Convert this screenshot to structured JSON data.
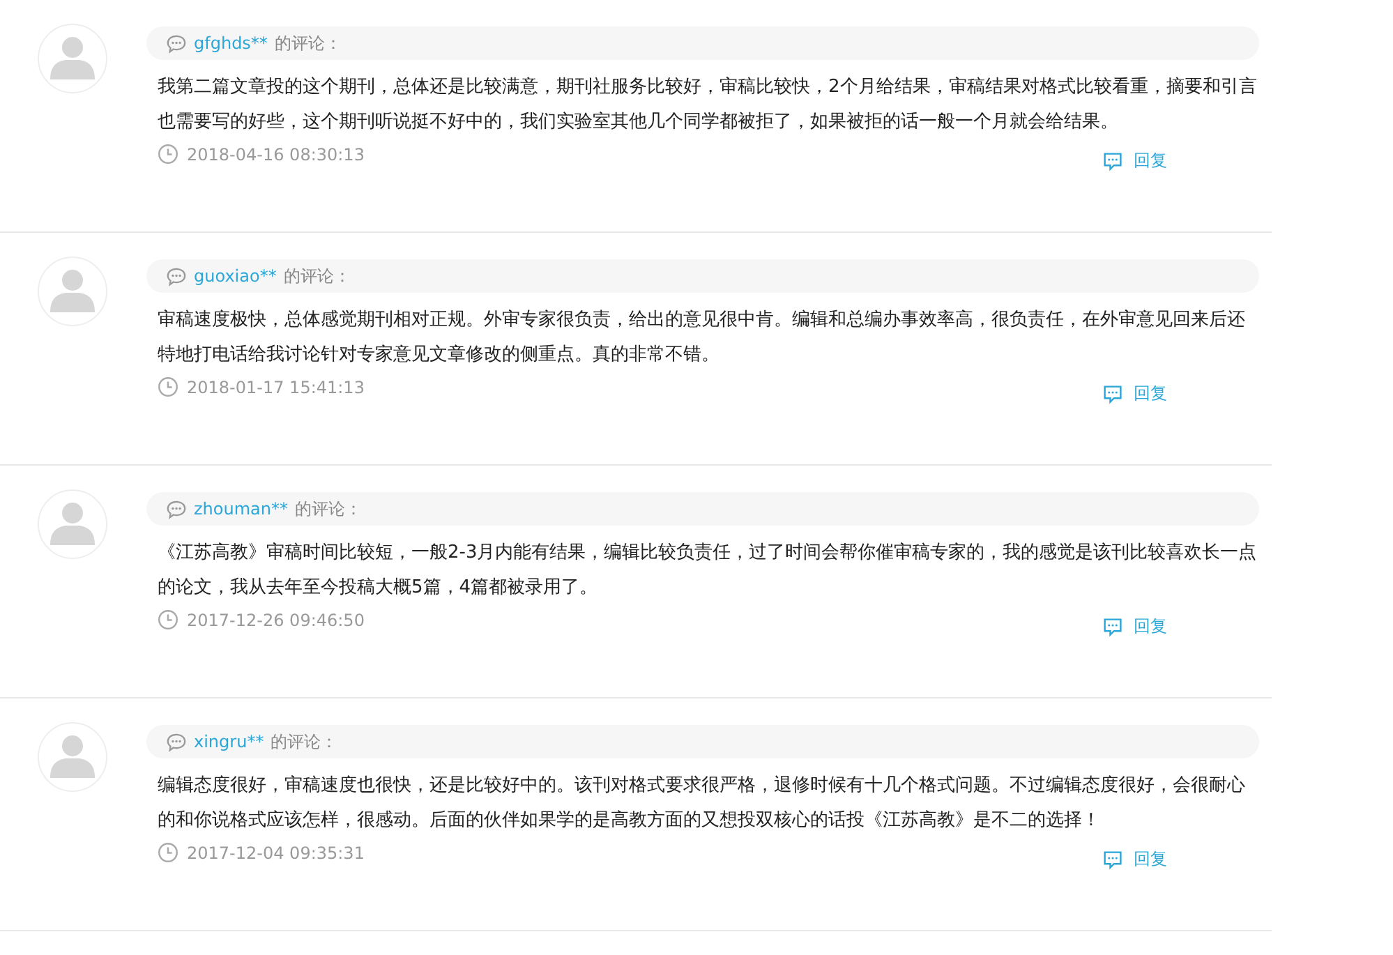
{
  "comments": [
    {
      "user": "gfghds**",
      "suffix": "的评论：",
      "text": "我第二篇文章投的这个期刊，总体还是比较满意，期刊社服务比较好，审稿比较快，2个月给结果，审稿结果对格式比较看重，摘要和引言也需要写的好些，这个期刊听说挺不好中的，我们实验室其他几个同学都被拒了，如果被拒的话一般一个月就会给结果。",
      "time": "2018-04-16 08:30:13",
      "reply": "回复"
    },
    {
      "user": "guoxiao**",
      "suffix": "的评论：",
      "text": "审稿速度极快，总体感觉期刊相对正规。外审专家很负责，给出的意见很中肯。编辑和总编办事效率高，很负责任，在外审意见回来后还特地打电话给我讨论针对专家意见文章修改的侧重点。真的非常不错。",
      "time": "2018-01-17 15:41:13",
      "reply": "回复"
    },
    {
      "user": "zhouman**",
      "suffix": "的评论：",
      "text": "《江苏高教》审稿时间比较短，一般2-3月内能有结果，编辑比较负责任，过了时间会帮你催审稿专家的，我的感觉是该刊比较喜欢长一点的论文，我从去年至今投稿大概5篇，4篇都被录用了。",
      "time": "2017-12-26 09:46:50",
      "reply": "回复"
    },
    {
      "user": "xingru**",
      "suffix": "的评论：",
      "text": "编辑态度很好，审稿速度也很快，还是比较好中的。该刊对格式要求很严格，退修时候有十几个格式问题。不过编辑态度很好，会很耐心的和你说格式应该怎样，很感动。后面的伙伴如果学的是高教方面的又想投双核心的话投《江苏高教》是不二的选择！",
      "time": "2017-12-04 09:35:31",
      "reply": "回复"
    }
  ]
}
